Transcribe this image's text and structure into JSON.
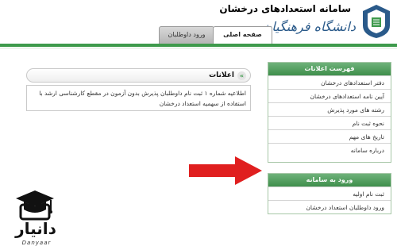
{
  "header": {
    "site_title": "سامانه استعدادهای درخشان",
    "logo_text": "دانشگاه فرهنگیان",
    "tabs": [
      {
        "label": "صفحه اصلی",
        "active": true
      },
      {
        "label": "ورود داوطلبان",
        "active": false
      }
    ]
  },
  "announcements": {
    "title": "اعلانات",
    "body": "اطلاعیه شماره ۱ ثبت نام داوطلبان پذیرش بدون آزمون در مقطع کارشناسی ارشد با استفاده از سهمیه استعداد درخشان"
  },
  "menu_list": {
    "title": "فهرست اعلانات",
    "items": [
      "دفتر استعدادهای درخشان",
      "آیین نامه استعدادهای درخشان",
      "رشته های مورد پذیرش",
      "نحوه ثبت نام",
      "تاریخ های مهم",
      "درباره سامانه"
    ]
  },
  "login_box": {
    "title": "ورود به سامانه",
    "items": [
      "ثبت نام اولیه",
      "ورود داوطلبان استعداد درخشان"
    ]
  },
  "watermark": {
    "brand": "دانیار",
    "sub": "Danyaar"
  },
  "colors": {
    "accent_green": "#3e9a4c",
    "arrow_red": "#e01f1f"
  }
}
